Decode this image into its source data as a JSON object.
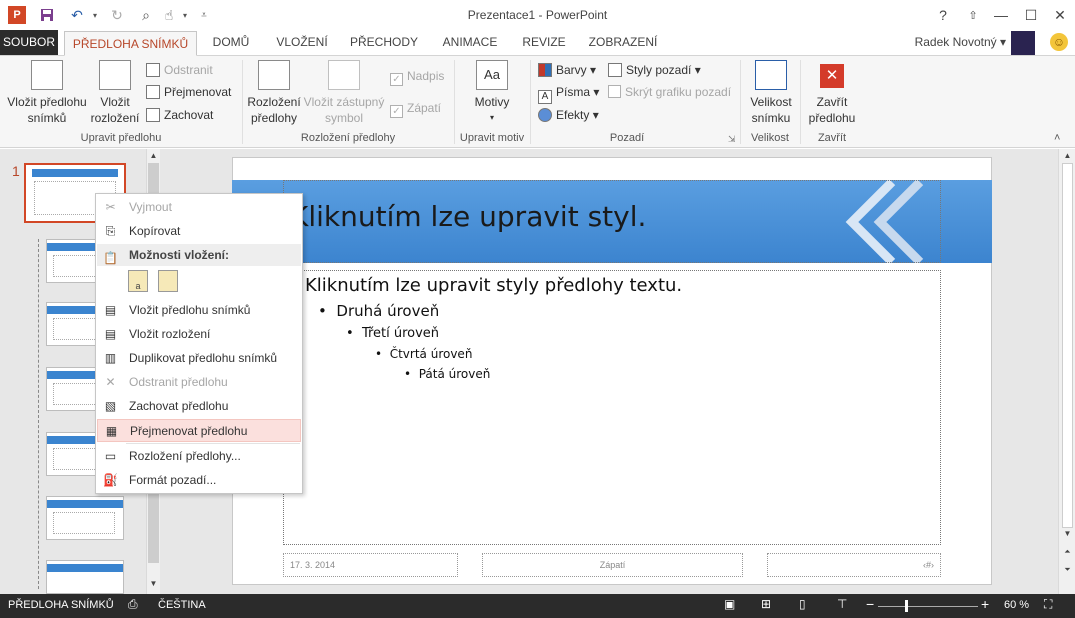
{
  "window": {
    "title": "Prezentace1 - PowerPoint",
    "help": "?",
    "restore_ribbon": "⇧",
    "minimize": "—",
    "maximize": "☐",
    "close": "✕"
  },
  "qat": {
    "app_icon": "P",
    "save_icon": "save-icon",
    "undo_icon": "undo-icon",
    "redo_icon": "redo-icon"
  },
  "tabs": {
    "file": "SOUBOR",
    "items": [
      "PŘEDLOHA SNÍMKŮ",
      "DOMŮ",
      "VLOŽENÍ",
      "PŘECHODY",
      "ANIMACE",
      "REVIZE",
      "ZOBRAZENÍ"
    ],
    "user": "Radek Novotný"
  },
  "ribbon": {
    "insert_master": "Vložit předlohu snímků",
    "insert_layout": "Vložit rozložení",
    "delete": "Odstranit",
    "rename": "Přejmenovat",
    "preserve": "Zachovat",
    "group_edit_master": "Upravit předlohu",
    "master_layout": "Rozložení předlohy",
    "insert_placeholder": "Vložit zástupný symbol",
    "title_chk": "Nadpis",
    "footer_chk": "Zápatí",
    "group_master_layout": "Rozložení předlohy",
    "themes": "Motivy",
    "group_edit_theme": "Upravit motiv",
    "colors": "Barvy",
    "fonts": "Písma",
    "effects": "Efekty",
    "bg_styles": "Styly pozadí",
    "hide_bg": "Skrýt grafiku pozadí",
    "group_background": "Pozadí",
    "slide_size": "Velikost snímku",
    "group_size": "Velikost",
    "close_master": "Zavřít předlohu",
    "group_close": "Zavřít"
  },
  "left_pane": {
    "slide_number": "1"
  },
  "slide": {
    "title": "Kliknutím lze upravit styl.",
    "level1": "Kliknutím lze upravit styly předlohy textu.",
    "level2": "Druhá úroveň",
    "level3": "Třetí úroveň",
    "level4": "Čtvrtá úroveň",
    "level5": "Pátá úroveň",
    "footer_date": "17. 3. 2014",
    "footer_center": "Zápatí",
    "footer_num": "‹#›"
  },
  "context_menu": {
    "cut": "Vyjmout",
    "copy": "Kopírovat",
    "paste_options": "Možnosti vložení:",
    "insert_master": "Vložit předlohu snímků",
    "insert_layout": "Vložit rozložení",
    "duplicate": "Duplikovat předlohu snímků",
    "delete": "Odstranit předlohu",
    "preserve": "Zachovat předlohu",
    "rename": "Přejmenovat předlohu",
    "master_layout": "Rozložení předlohy...",
    "format_bg": "Formát pozadí..."
  },
  "status": {
    "view": "PŘEDLOHA SNÍMKŮ",
    "language": "ČEŠTINA",
    "zoom": "60 %",
    "zoom_level": 0.6
  },
  "colors": {
    "accent": "#b7472a",
    "blue_band": "#3c84cf",
    "highlight": "#fbe0dd"
  }
}
